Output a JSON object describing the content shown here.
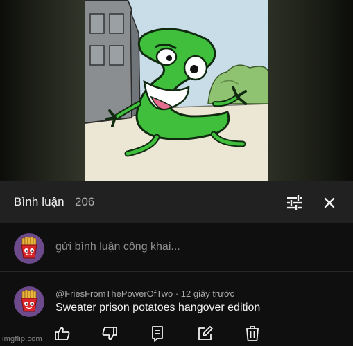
{
  "comments_panel": {
    "title": "Bình luận",
    "count": "206",
    "filter_icon": "sliders-icon",
    "close_icon": "close-icon"
  },
  "compose": {
    "placeholder": "gửi bình luận công khai...",
    "avatar_icon": "fries-avatar"
  },
  "comments": [
    {
      "author": "@FriesFromThePowerOfTwo",
      "time": "12 giây trước",
      "meta": "@FriesFromThePowerOfTwo · 12 giây trước",
      "text": "Sweater prison potatoes hangover edition",
      "actions": [
        "like-icon",
        "dislike-icon",
        "reply-icon",
        "edit-icon",
        "delete-icon"
      ]
    }
  ],
  "watermark": "imgflip.com"
}
